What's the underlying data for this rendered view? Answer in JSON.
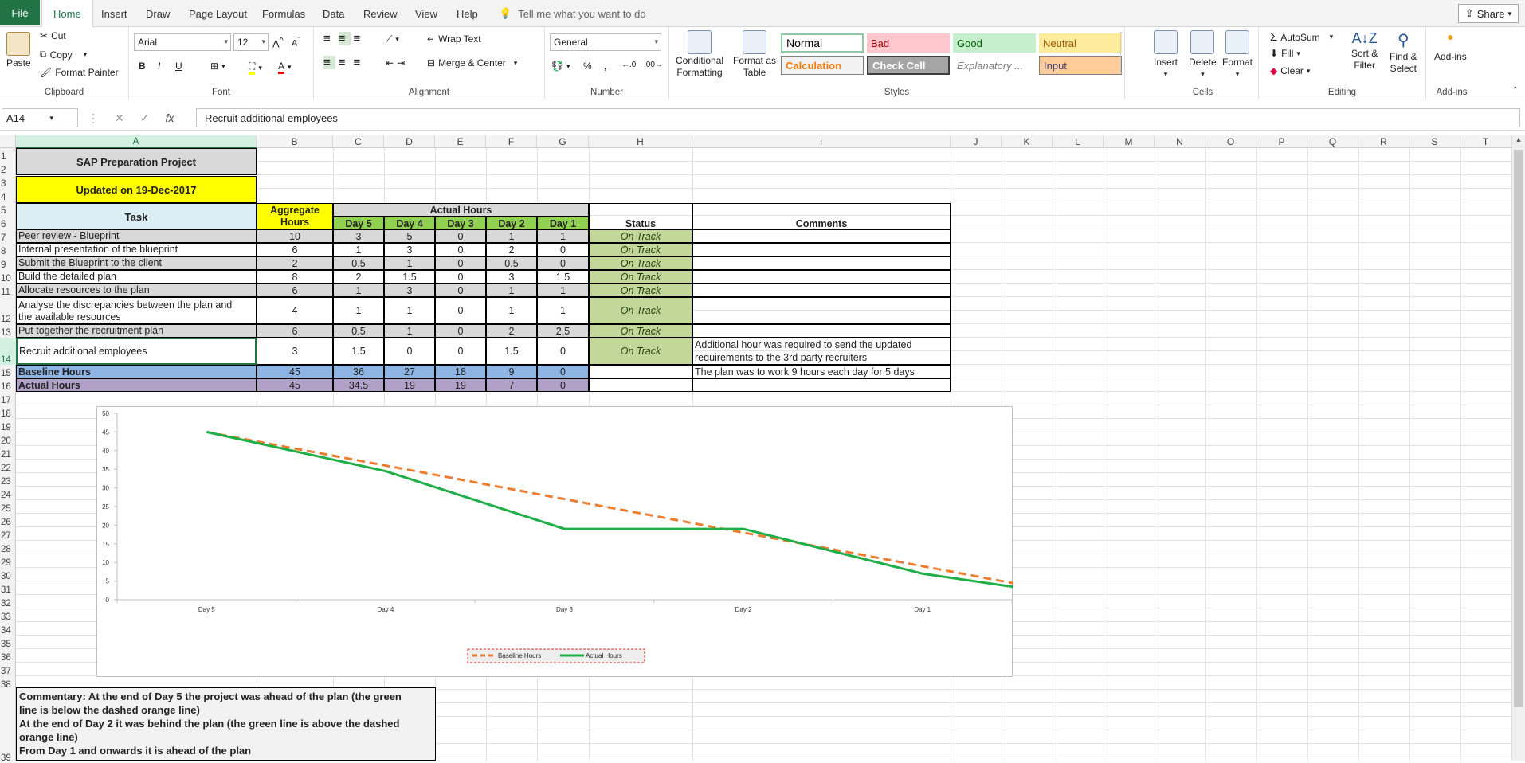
{
  "tabs": {
    "file": "File",
    "home": "Home",
    "insert": "Insert",
    "draw": "Draw",
    "page_layout": "Page Layout",
    "formulas": "Formulas",
    "data": "Data",
    "review": "Review",
    "view": "View",
    "help": "Help"
  },
  "tell_me": "Tell me what you want to do",
  "share": "Share",
  "ribbon": {
    "clipboard": {
      "paste": "Paste",
      "cut": "Cut",
      "copy": "Copy",
      "format_painter": "Format Painter",
      "label": "Clipboard"
    },
    "font": {
      "name": "Arial",
      "size": "12",
      "bold": "B",
      "italic": "I",
      "underline": "U",
      "label": "Font"
    },
    "alignment": {
      "wrap_text": "Wrap Text",
      "merge_center": "Merge & Center",
      "label": "Alignment"
    },
    "number": {
      "format": "General",
      "percent": "%",
      "comma": ",",
      "label": "Number"
    },
    "styles": {
      "conditional": "Conditional",
      "conditional2": "Formatting",
      "format_table": "Format as",
      "format_table2": "Table",
      "normal": "Normal",
      "bad": "Bad",
      "good": "Good",
      "neutral": "Neutral",
      "calculation": "Calculation",
      "check_cell": "Check Cell",
      "explanatory": "Explanatory ...",
      "input": "Input",
      "label": "Styles"
    },
    "cells": {
      "insert": "Insert",
      "delete": "Delete",
      "format": "Format",
      "label": "Cells"
    },
    "editing": {
      "autosum": "AutoSum",
      "fill": "Fill",
      "clear": "Clear",
      "sort_filter": "Sort &",
      "sort_filter2": "Filter",
      "find_select": "Find &",
      "find_select2": "Select",
      "label": "Editing"
    },
    "addins": {
      "addins": "Add-ins",
      "label": "Add-ins"
    }
  },
  "formula_bar": {
    "name_box": "A14",
    "formula": "Recruit additional employees"
  },
  "columns": [
    "A",
    "B",
    "C",
    "D",
    "E",
    "F",
    "G",
    "H",
    "I",
    "J",
    "K",
    "L",
    "M",
    "N",
    "O",
    "P",
    "Q",
    "R",
    "S",
    "T"
  ],
  "rows": [
    "1",
    "2",
    "3",
    "4",
    "5",
    "6",
    "7",
    "8",
    "9",
    "10",
    "11",
    "12",
    "13",
    "14",
    "15",
    "16",
    "17",
    "18",
    "19",
    "20",
    "21",
    "22",
    "23",
    "24",
    "25",
    "26",
    "27",
    "28",
    "29",
    "30",
    "31",
    "32",
    "33",
    "34",
    "35",
    "36",
    "37",
    "38",
    "39"
  ],
  "sheet": {
    "title": "SAP Preparation Project",
    "updated": "Updated on 19-Dec-2017",
    "task_header": "Task",
    "aggregate_header": "Aggregate Hours",
    "actual_hours_header": "Actual Hours",
    "day_headers": [
      "Day 5",
      "Day 4",
      "Day 3",
      "Day 2",
      "Day 1"
    ],
    "status_header": "Status",
    "comments_header": "Comments",
    "tasks": [
      {
        "task": "Peer review - Blueprint",
        "agg": "10",
        "d": [
          "3",
          "5",
          "0",
          "1",
          "1"
        ],
        "status": "On Track",
        "comment": ""
      },
      {
        "task": "Internal presentation of the blueprint",
        "agg": "6",
        "d": [
          "1",
          "3",
          "0",
          "2",
          "0"
        ],
        "status": "On Track",
        "comment": ""
      },
      {
        "task": "Submit the Blueprint to the client",
        "agg": "2",
        "d": [
          "0.5",
          "1",
          "0",
          "0.5",
          "0"
        ],
        "status": "On Track",
        "comment": ""
      },
      {
        "task": "Build the detailed plan",
        "agg": "8",
        "d": [
          "2",
          "1.5",
          "0",
          "3",
          "1.5"
        ],
        "status": "On Track",
        "comment": ""
      },
      {
        "task": "Allocate resources to the plan",
        "agg": "6",
        "d": [
          "1",
          "3",
          "0",
          "1",
          "1"
        ],
        "status": "On Track",
        "comment": ""
      },
      {
        "task": "Analyse the discrepancies between the plan and",
        "task2": "the available resources",
        "agg": "4",
        "d": [
          "1",
          "1",
          "0",
          "1",
          "1"
        ],
        "status": "On Track",
        "comment": ""
      },
      {
        "task": "Put together the recruitment plan",
        "agg": "6",
        "d": [
          "0.5",
          "1",
          "0",
          "2",
          "2.5"
        ],
        "status": "On Track",
        "comment": ""
      },
      {
        "task": "Recruit additional employees",
        "agg": "3",
        "d": [
          "1.5",
          "0",
          "0",
          "1.5",
          "0"
        ],
        "status": "On Track",
        "comment": "Additional hour was required to send the updated",
        "comment2": "requirements to the 3rd party recruiters"
      }
    ],
    "baseline": {
      "label": "Baseline Hours",
      "agg": "45",
      "d": [
        "36",
        "27",
        "18",
        "9",
        "0"
      ],
      "comment": "The plan was to work 9 hours each day for 5 days"
    },
    "actual": {
      "label": "Actual Hours",
      "agg": "45",
      "d": [
        "34.5",
        "19",
        "19",
        "7",
        "0"
      ]
    }
  },
  "chart_data": {
    "type": "line",
    "categories": [
      "Day 5",
      "Day 4",
      "Day 3",
      "Day 2",
      "Day 1"
    ],
    "series": [
      {
        "name": "Baseline Hours",
        "values": [
          45,
          36,
          27,
          18,
          9,
          0
        ],
        "color": "#ED7D31",
        "dashed": true
      },
      {
        "name": "Actual Hours",
        "values": [
          45,
          34.5,
          19,
          19,
          7,
          0
        ],
        "color": "#1FAE48",
        "dashed": false
      }
    ],
    "y_ticks": [
      0,
      5,
      10,
      15,
      20,
      25,
      30,
      35,
      40,
      45,
      50
    ],
    "ylim": [
      0,
      50
    ],
    "legend": "bottom"
  },
  "commentary": [
    "Commentary: At the end of Day 5 the project was ahead of the plan (the green",
    "line is below the dashed orange line)",
    "At the end of Day 2 it was behind the plan (the green line is above the dashed",
    "orange line)",
    "From Day 1 and onwards it is ahead of the plan"
  ]
}
